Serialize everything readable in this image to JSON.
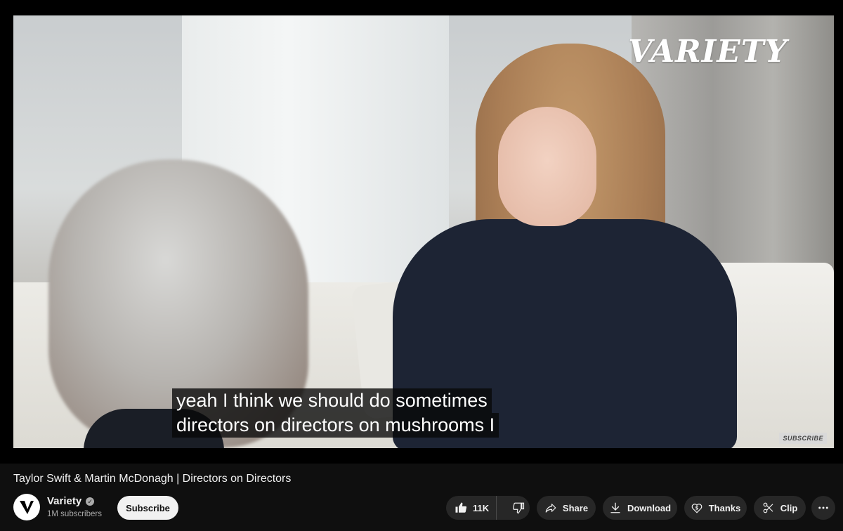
{
  "video": {
    "brand_logo_text": "VARIETY",
    "captions": [
      "yeah I think we should do sometimes",
      "directors on directors on mushrooms I"
    ],
    "watermark_text": "SUBSCRIBE"
  },
  "title": "Taylor Swift & Martin McDonagh | Directors on Directors",
  "channel": {
    "name": "Variety",
    "subscribers": "1M subscribers",
    "avatar_letter": "V"
  },
  "actions": {
    "subscribe": "Subscribe",
    "likes": "11K",
    "share": "Share",
    "download": "Download",
    "thanks": "Thanks",
    "clip": "Clip"
  },
  "icons": {
    "like": "thumbs-up-icon",
    "dislike": "thumbs-down-icon",
    "share": "share-arrow-icon",
    "download": "download-icon",
    "thanks": "dollar-heart-icon",
    "clip": "scissors-icon",
    "more": "more-horizontal-icon",
    "verified": "verified-check-icon"
  }
}
